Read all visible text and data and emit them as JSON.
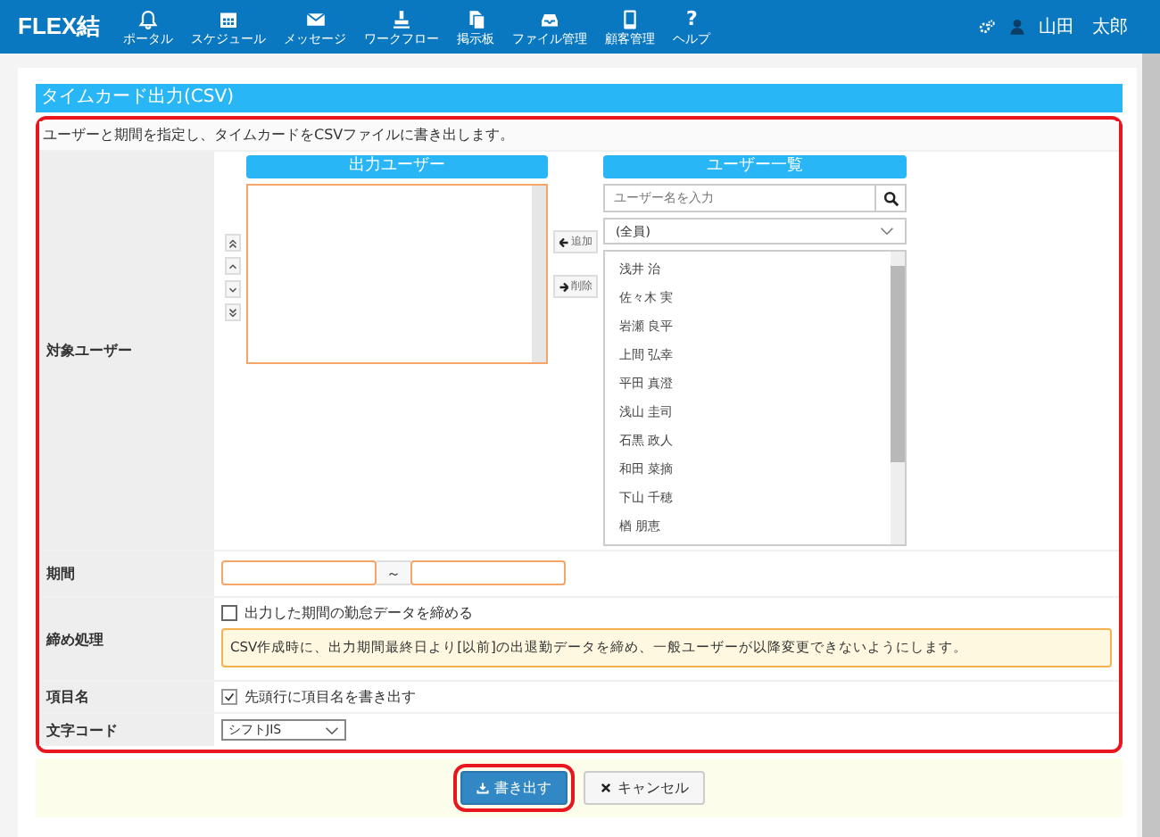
{
  "header": {
    "logo": "FLEX結",
    "nav": [
      {
        "label": "ポータル"
      },
      {
        "label": "スケジュール"
      },
      {
        "label": "メッセージ"
      },
      {
        "label": "ワークフロー"
      },
      {
        "label": "掲示板"
      },
      {
        "label": "ファイル管理"
      },
      {
        "label": "顧客管理"
      },
      {
        "label": "ヘルプ",
        "icon_text": "?"
      }
    ],
    "user": "山田　太郎"
  },
  "panel_title": "タイムカード出力(CSV)",
  "form": {
    "highlighted": true,
    "description": "ユーザーと期間を指定し、タイムカードをCSVファイルに書き出します。",
    "target_users": {
      "label": "対象ユーザー",
      "output_heading": "出力ユーザー",
      "add_button": "追加",
      "remove_button": "削除",
      "list_heading": "ユーザー一覧",
      "search": {
        "placeholder": "ユーザー名を入力"
      },
      "group_select": "(全員)",
      "users": [
        "浅井 治",
        "佐々木 実",
        "岩瀬 良平",
        "上間 弘幸",
        "平田 真澄",
        "浅山 圭司",
        "石黒 政人",
        "和田 菜摘",
        "下山 千穂",
        "楢 朋恵"
      ]
    },
    "period": {
      "label": "期間",
      "separator": "～"
    },
    "closing": {
      "label": "締め処理",
      "checkbox": {
        "label": "出力した期間の勤怠データを締める",
        "checked": false
      },
      "note": "CSV作成時に、出力期間最終日より[以前]の出退勤データを締め、一般ユーザーが以降変更できないようにします。"
    },
    "column_names": {
      "label": "項目名",
      "checkbox": {
        "label": "先頭行に項目名を書き出す",
        "checked": true
      }
    },
    "encoding": {
      "label": "文字コード",
      "value": "シフトJIS"
    }
  },
  "buttons": [
    {
      "label": "書き出す",
      "kind": "primary",
      "highlighted": true
    },
    {
      "label": "キャンセル",
      "kind": "secondary",
      "highlighted": false
    }
  ]
}
